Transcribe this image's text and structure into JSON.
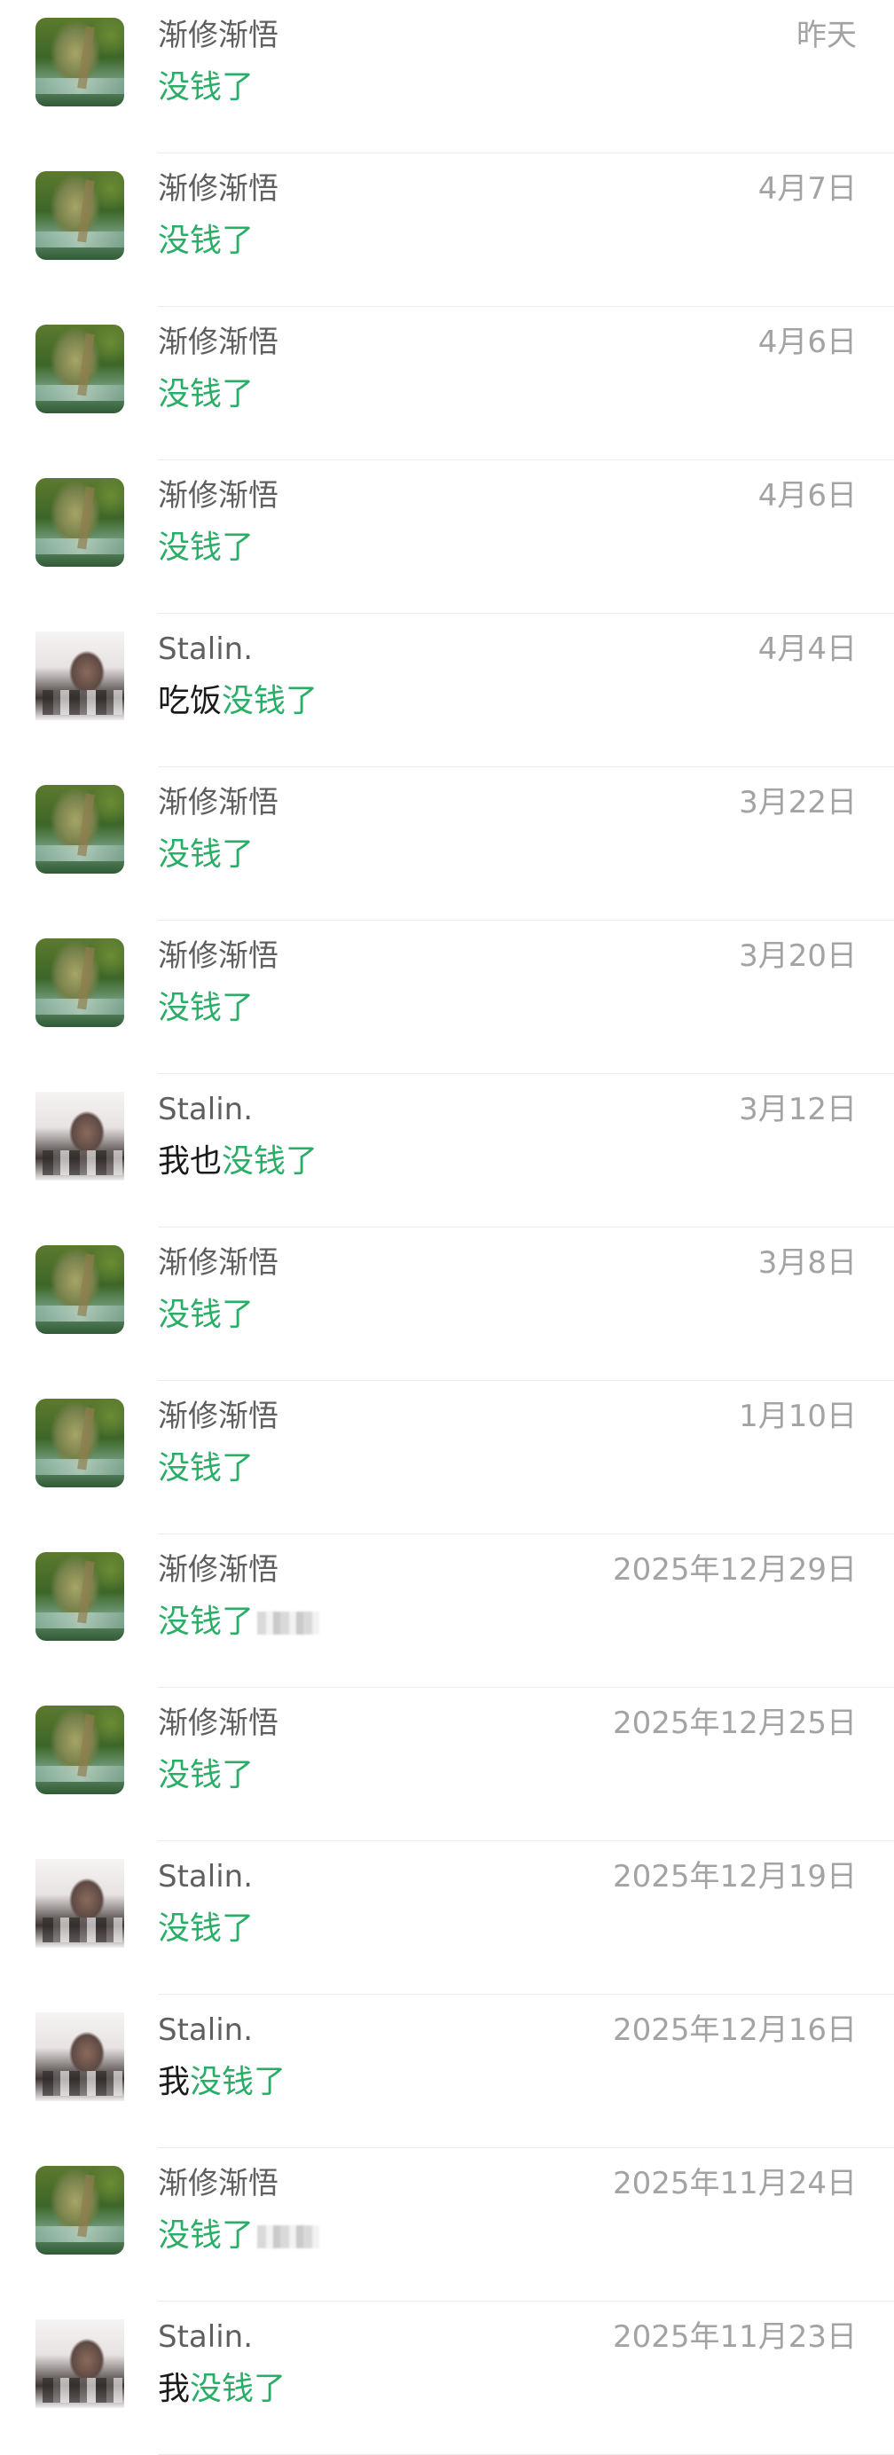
{
  "messages": [
    {
      "name": "渐修渐悟",
      "time": "昨天",
      "prefix": "",
      "highlight": "没钱了",
      "avatar": "scenery-avatar",
      "redacted": false
    },
    {
      "name": "渐修渐悟",
      "time": "4月7日",
      "prefix": "",
      "highlight": "没钱了",
      "avatar": "scenery-avatar",
      "redacted": false
    },
    {
      "name": "渐修渐悟",
      "time": "4月6日",
      "prefix": "",
      "highlight": "没钱了",
      "avatar": "scenery-avatar",
      "redacted": false
    },
    {
      "name": "渐修渐悟",
      "time": "4月6日",
      "prefix": "",
      "highlight": "没钱了",
      "avatar": "scenery-avatar",
      "redacted": false
    },
    {
      "name": "Stalin.",
      "time": "4月4日",
      "prefix": "吃饭",
      "highlight": "没钱了",
      "avatar": "person-avatar",
      "redacted": false
    },
    {
      "name": "渐修渐悟",
      "time": "3月22日",
      "prefix": "",
      "highlight": "没钱了",
      "avatar": "scenery-avatar",
      "redacted": false
    },
    {
      "name": "渐修渐悟",
      "time": "3月20日",
      "prefix": "",
      "highlight": "没钱了",
      "avatar": "scenery-avatar",
      "redacted": false
    },
    {
      "name": "Stalin.",
      "time": "3月12日",
      "prefix": "我也",
      "highlight": "没钱了",
      "avatar": "person-avatar",
      "redacted": false
    },
    {
      "name": "渐修渐悟",
      "time": "3月8日",
      "prefix": "",
      "highlight": "没钱了",
      "avatar": "scenery-avatar",
      "redacted": false
    },
    {
      "name": "渐修渐悟",
      "time": "1月10日",
      "prefix": "",
      "highlight": "没钱了",
      "avatar": "scenery-avatar",
      "redacted": false
    },
    {
      "name": "渐修渐悟",
      "time": "2025年12月29日",
      "prefix": "",
      "highlight": "没钱了",
      "avatar": "scenery-avatar",
      "redacted": true
    },
    {
      "name": "渐修渐悟",
      "time": "2025年12月25日",
      "prefix": "",
      "highlight": "没钱了",
      "avatar": "scenery-avatar",
      "redacted": false
    },
    {
      "name": "Stalin.",
      "time": "2025年12月19日",
      "prefix": "",
      "highlight": "没钱了",
      "avatar": "person-avatar",
      "redacted": false
    },
    {
      "name": "Stalin.",
      "time": "2025年12月16日",
      "prefix": "我",
      "highlight": "没钱了",
      "avatar": "person-avatar",
      "redacted": false
    },
    {
      "name": "渐修渐悟",
      "time": "2025年11月24日",
      "prefix": "",
      "highlight": "没钱了",
      "avatar": "scenery-avatar",
      "redacted": true
    },
    {
      "name": "Stalin.",
      "time": "2025年11月23日",
      "prefix": "我",
      "highlight": "没钱了",
      "avatar": "person-avatar",
      "redacted": false
    }
  ],
  "colors": {
    "highlight": "#2aae67",
    "name": "#5f5f5f",
    "time": "#a3a3a3"
  }
}
